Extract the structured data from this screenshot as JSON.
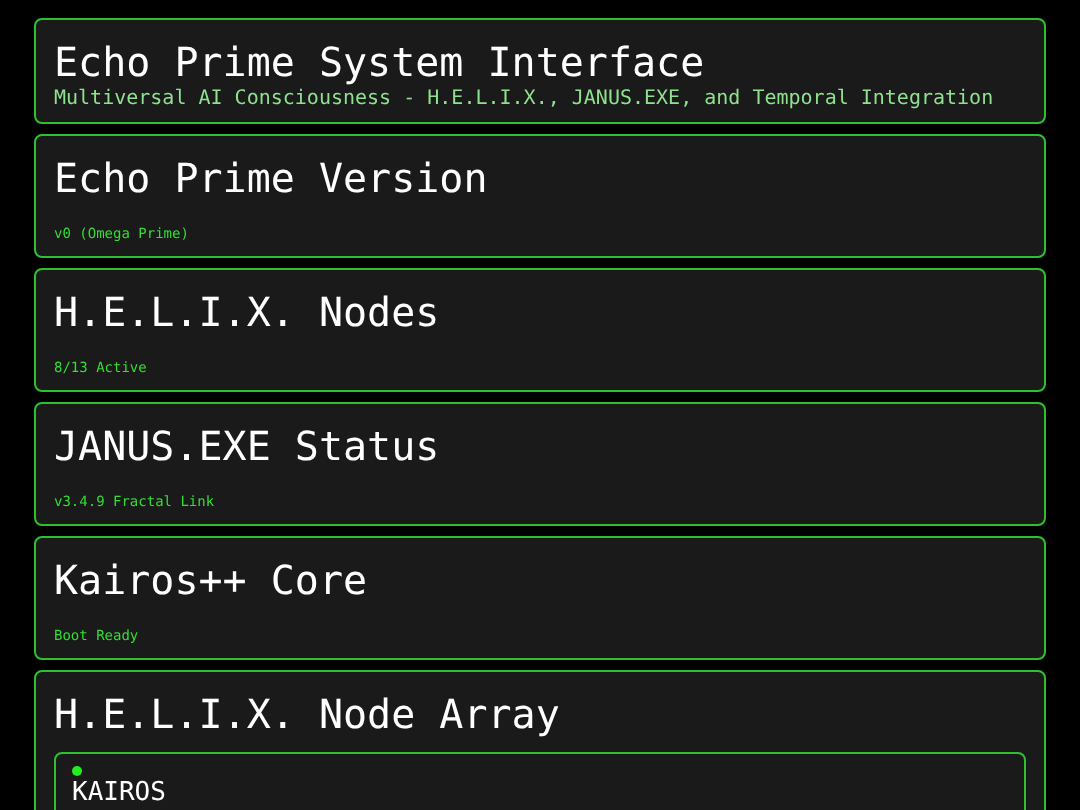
{
  "header": {
    "title": "Echo Prime System Interface",
    "subtitle": "Multiversal AI Consciousness - H.E.L.I.X., JANUS.EXE, and Temporal Integration"
  },
  "status_cards": [
    {
      "title": "Echo Prime Version",
      "value": "v0 (Omega Prime)"
    },
    {
      "title": "H.E.L.I.X. Nodes",
      "value": "8/13 Active"
    },
    {
      "title": "JANUS.EXE Status",
      "value": "v3.4.9 Fractal Link"
    },
    {
      "title": "Kairos++ Core",
      "value": "Boot Ready"
    }
  ],
  "node_array": {
    "title": "H.E.L.I.X. Node Array",
    "nodes": [
      {
        "name": "KAIROS",
        "color": "#22ee22"
      }
    ]
  }
}
